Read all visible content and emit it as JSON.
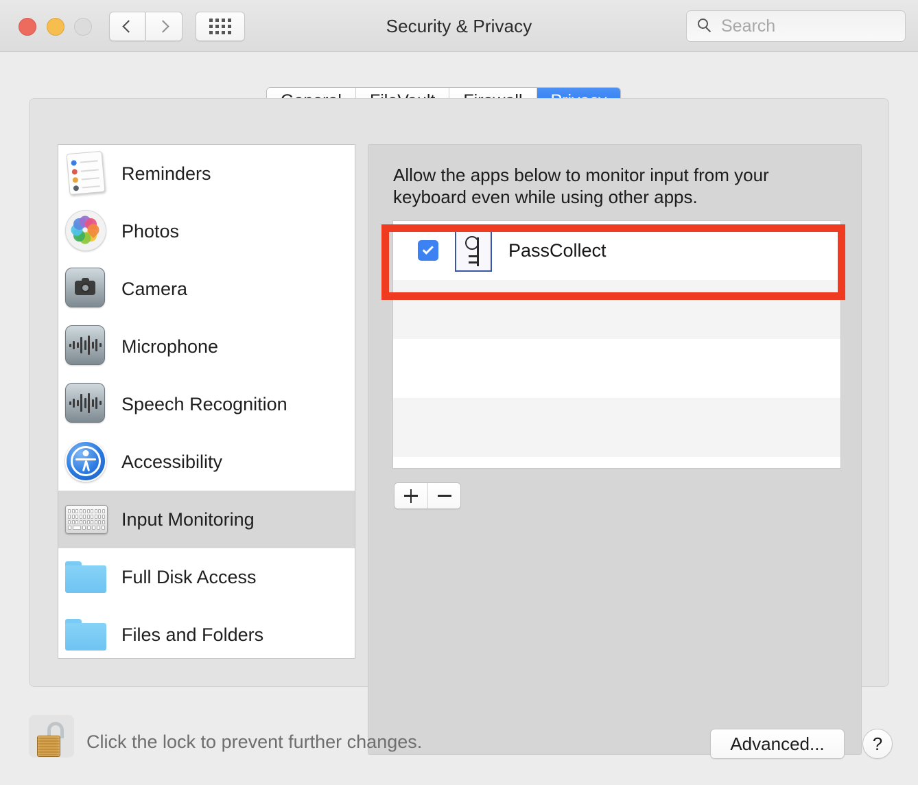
{
  "window": {
    "title": "Security & Privacy",
    "traffic_lights": [
      "close",
      "minimize",
      "zoom"
    ],
    "back_icon": "chevron-left-icon",
    "forward_icon": "chevron-right-icon",
    "grid_icon": "show-all-grid-icon"
  },
  "search": {
    "placeholder": "Search",
    "value": "",
    "icon": "search-icon"
  },
  "tabs": [
    {
      "label": "General",
      "active": false
    },
    {
      "label": "FileVault",
      "active": false
    },
    {
      "label": "Firewall",
      "active": false
    },
    {
      "label": "Privacy",
      "active": true
    }
  ],
  "sidebar": {
    "items": [
      {
        "label": "Reminders",
        "icon": "reminders-icon",
        "selected": false
      },
      {
        "label": "Photos",
        "icon": "photos-icon",
        "selected": false
      },
      {
        "label": "Camera",
        "icon": "camera-icon",
        "selected": false
      },
      {
        "label": "Microphone",
        "icon": "microphone-icon",
        "selected": false
      },
      {
        "label": "Speech Recognition",
        "icon": "speech-icon",
        "selected": false
      },
      {
        "label": "Accessibility",
        "icon": "accessibility-icon",
        "selected": false
      },
      {
        "label": "Input Monitoring",
        "icon": "keyboard-icon",
        "selected": true
      },
      {
        "label": "Full Disk Access",
        "icon": "folder-icon",
        "selected": false
      },
      {
        "label": "Files and Folders",
        "icon": "folder-icon",
        "selected": false
      }
    ]
  },
  "detail": {
    "description": "Allow the apps below to monitor input from your keyboard even while using other apps.",
    "apps": [
      {
        "name": "PassCollect",
        "checked": true,
        "icon": "key-app-icon",
        "highlighted": true
      }
    ],
    "add_label": "+",
    "remove_label": "—"
  },
  "bottom": {
    "lock_icon": "unlocked-padlock-icon",
    "lock_text": "Click the lock to prevent further changes.",
    "advanced_label": "Advanced...",
    "help_label": "?"
  },
  "colors": {
    "accent_blue": "#2272EE",
    "checkbox_blue": "#3C82F3",
    "highlight_red": "#EF3B20",
    "selected_row": "#D7D7D7",
    "window_bg": "#ECECEC"
  }
}
